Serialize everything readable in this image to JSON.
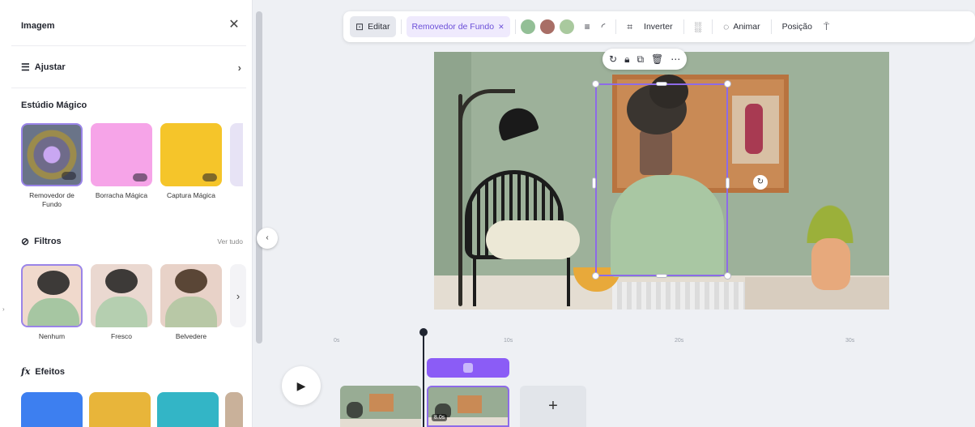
{
  "panel": {
    "title": "Imagem",
    "adjust_label": "Ajustar",
    "magic_studio": {
      "title": "Estúdio Mágico",
      "items": [
        {
          "label": "Removedor de Fundo"
        },
        {
          "label": "Borracha Mágica"
        },
        {
          "label": "Captura Mágica"
        }
      ]
    },
    "filters": {
      "title": "Filtros",
      "see_all": "Ver tudo",
      "items": [
        {
          "label": "Nenhum",
          "selected": true
        },
        {
          "label": "Fresco",
          "selected": false
        },
        {
          "label": "Belvedere",
          "selected": false
        }
      ]
    },
    "effects": {
      "title": "Efeitos"
    }
  },
  "toolbar": {
    "edit": "Editar",
    "bg_remover": "Removedor de Fundo",
    "colors": [
      "#93bf96",
      "#a86e66",
      "#a9c99e"
    ],
    "flip": "Inverter",
    "animate": "Animar",
    "position": "Posição"
  },
  "timeline": {
    "ruler": [
      "0s",
      "10s",
      "20s",
      "30s"
    ],
    "clip_duration": "8.0s",
    "accent": "#8b5cf6"
  },
  "icons": {
    "close": "close-icon",
    "adjust": "sliders-icon",
    "filters": "filters-icon",
    "effects": "fx-icon",
    "play": "play-icon",
    "add": "plus-icon"
  }
}
